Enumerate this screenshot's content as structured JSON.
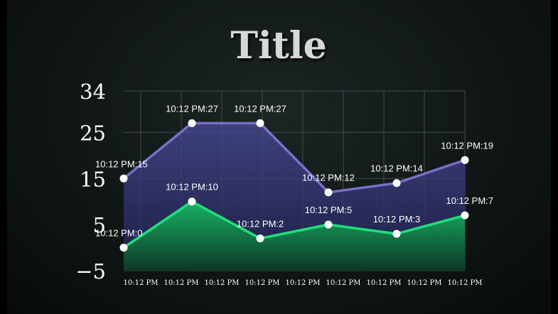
{
  "chart_data": {
    "type": "area",
    "title": "Title",
    "xlabel": "",
    "ylabel": "",
    "categories": [
      "10:12 PM",
      "10:12 PM",
      "10:12 PM",
      "10:12 PM",
      "10:12 PM",
      "10:12 PM"
    ],
    "x_tick_labels": [
      "10:12 PM",
      "10:12 PM",
      "10:12 PM",
      "10:12 PM",
      "10:12 PM",
      "10:12 PM",
      "10:12 PM",
      "10:12 PM",
      "10:12 PM"
    ],
    "y_ticks": [
      34,
      25,
      15,
      5,
      -5
    ],
    "ylim": [
      -5,
      34
    ],
    "grid": true,
    "series": [
      {
        "values": [
          15,
          27,
          27,
          12,
          14,
          19
        ],
        "labels": [
          "10:12 PM:15",
          "10:12 PM:27",
          "10:12 PM:27",
          "10:12 PM:12",
          "10:12 PM:14",
          "10:12 PM:19"
        ],
        "color": "#7a6fc9"
      },
      {
        "values": [
          0,
          10,
          2,
          5,
          3,
          7
        ],
        "labels": [
          "10:12 PM:0",
          "10:12 PM:10",
          "10:12 PM:2",
          "10:12 PM:5",
          "10:12 PM:3",
          "10:12 PM:7"
        ],
        "color": "#1fe07c"
      }
    ]
  }
}
